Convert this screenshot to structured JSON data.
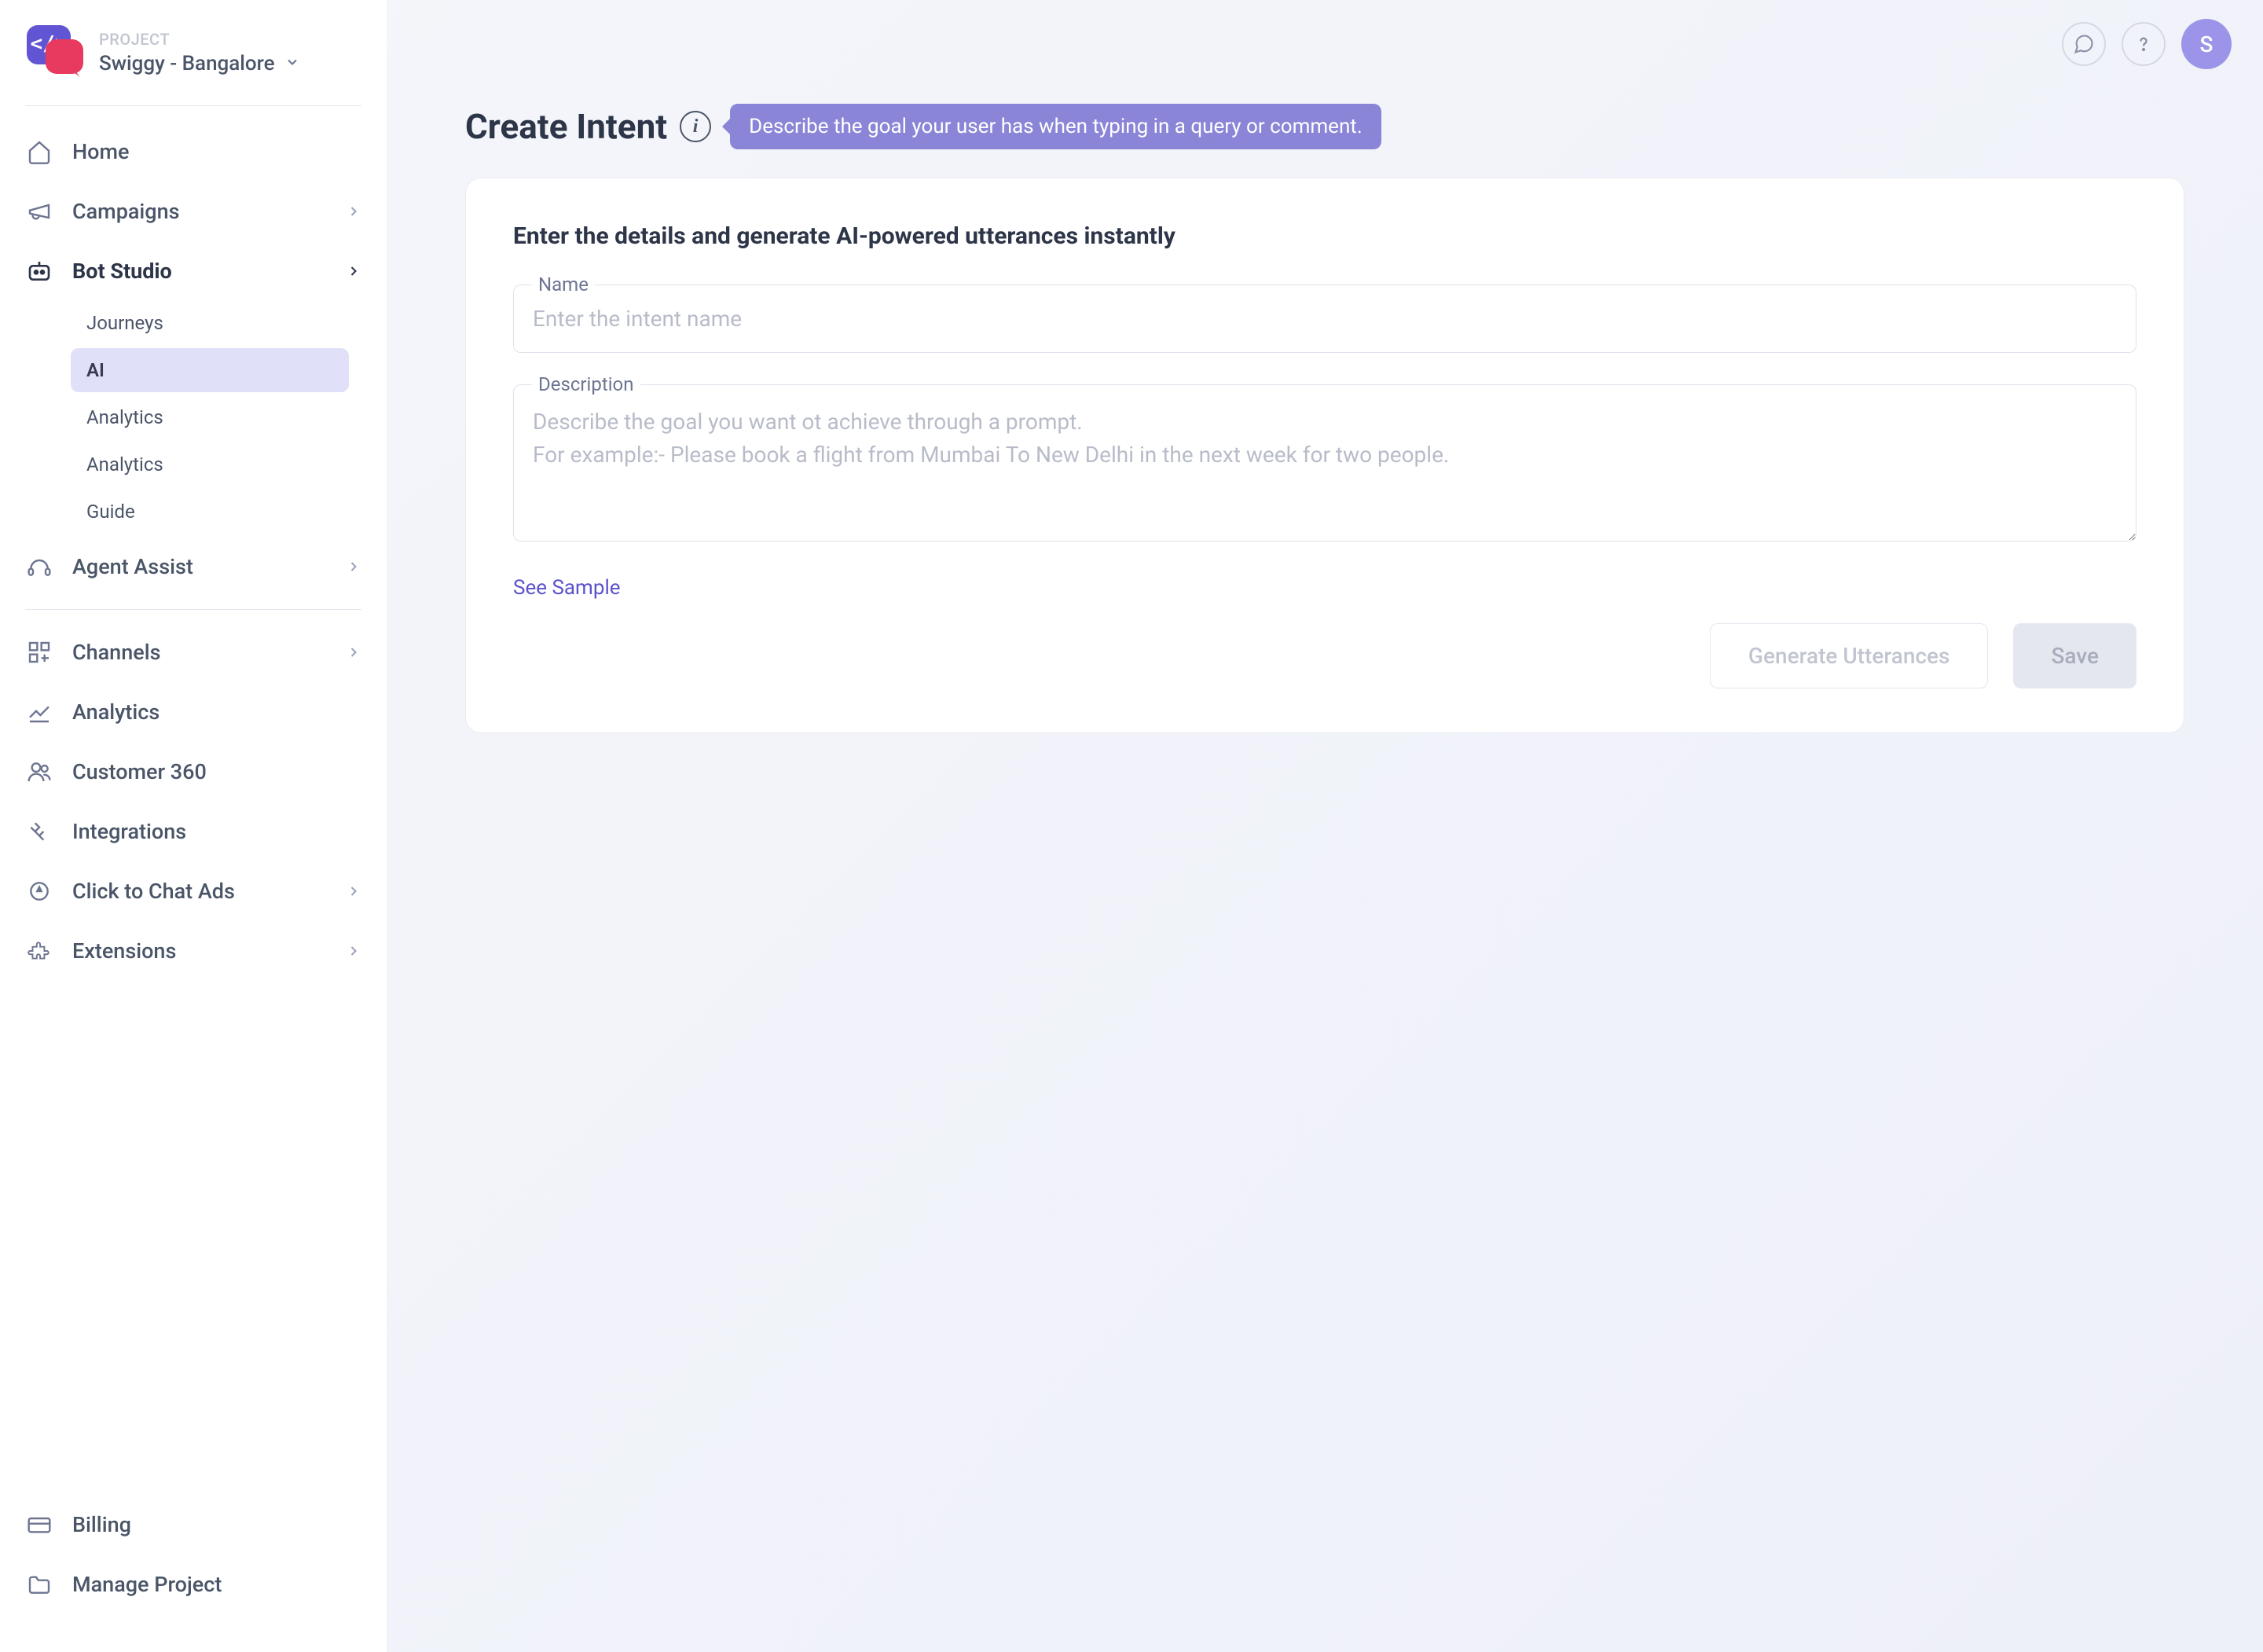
{
  "sidebar": {
    "project_label": "PROJECT",
    "project_name": "Swiggy - Bangalore",
    "nav": {
      "home": "Home",
      "campaigns": "Campaigns",
      "bot_studio": "Bot Studio",
      "agent_assist": "Agent Assist",
      "channels": "Channels",
      "analytics": "Analytics",
      "customer_360": "Customer 360",
      "integrations": "Integrations",
      "click_to_chat": "Click to Chat Ads",
      "extensions": "Extensions",
      "billing": "Billing",
      "manage_project": "Manage Project"
    },
    "subnav": {
      "journeys": "Journeys",
      "ai": "AI",
      "analytics1": "Analytics",
      "analytics2": "Analytics",
      "guide": "Guide"
    }
  },
  "topbar": {
    "avatar_initial": "S"
  },
  "page": {
    "title": "Create Intent",
    "tooltip": "Describe the goal your user has when typing in a query or comment."
  },
  "form": {
    "heading": "Enter the details and generate AI-powered utterances instantly",
    "name_label": "Name",
    "name_placeholder": "Enter the intent name",
    "description_label": "Description",
    "description_placeholder": "Describe the goal you want ot achieve through a prompt.\nFor example:- Please book a flight from Mumbai To New Delhi in the next week for two people.",
    "sample_link": "See Sample",
    "generate_btn": "Generate Utterances",
    "save_btn": "Save"
  }
}
